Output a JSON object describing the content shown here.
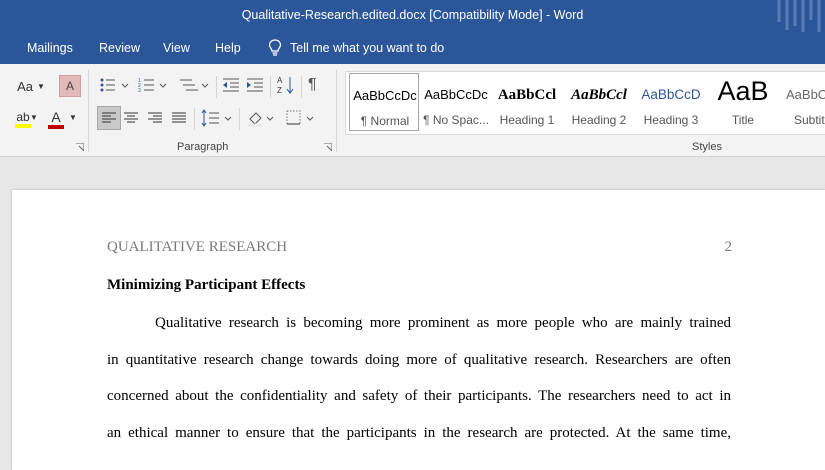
{
  "window": {
    "title": "Qualitative-Research.edited.docx [Compatibility Mode]  -  Word"
  },
  "menu": {
    "tabs": [
      "Mailings",
      "Review",
      "View",
      "Help"
    ],
    "tell_me": "Tell me what you want to do"
  },
  "ribbon": {
    "font_size_label": "Aa",
    "paragraph_group_label": "Paragraph",
    "styles_group_label": "Styles",
    "styles": [
      {
        "preview": "AaBbCcDc",
        "name": "¶ Normal"
      },
      {
        "preview": "AaBbCcDc",
        "name": "¶ No Spac..."
      },
      {
        "preview": "AaBbCcl",
        "name": "Heading 1"
      },
      {
        "preview": "AaBbCcl",
        "name": "Heading 2"
      },
      {
        "preview": "AaBbCcD",
        "name": "Heading 3"
      },
      {
        "preview": "AaB",
        "name": "Title"
      },
      {
        "preview": "AaBbCc",
        "name": "Subtit"
      }
    ],
    "colors": {
      "highlight": "#ffff00",
      "font_color": "#c00000",
      "accent": "#2b579a",
      "heading3": "#2f5496"
    }
  },
  "document": {
    "running_head": "QUALITATIVE RESEARCH",
    "page_number": "2",
    "heading": "Minimizing Participant Effects",
    "lines": [
      "Qualitative research is becoming more prominent as more people who are mainly trained",
      "in quantitative research change towards doing more of qualitative research. Researchers are often",
      "concerned about the confidentiality and safety of their participants. The researchers need to act in",
      "an ethical manner to ensure that the participants in the research are protected. At the same time,"
    ]
  }
}
